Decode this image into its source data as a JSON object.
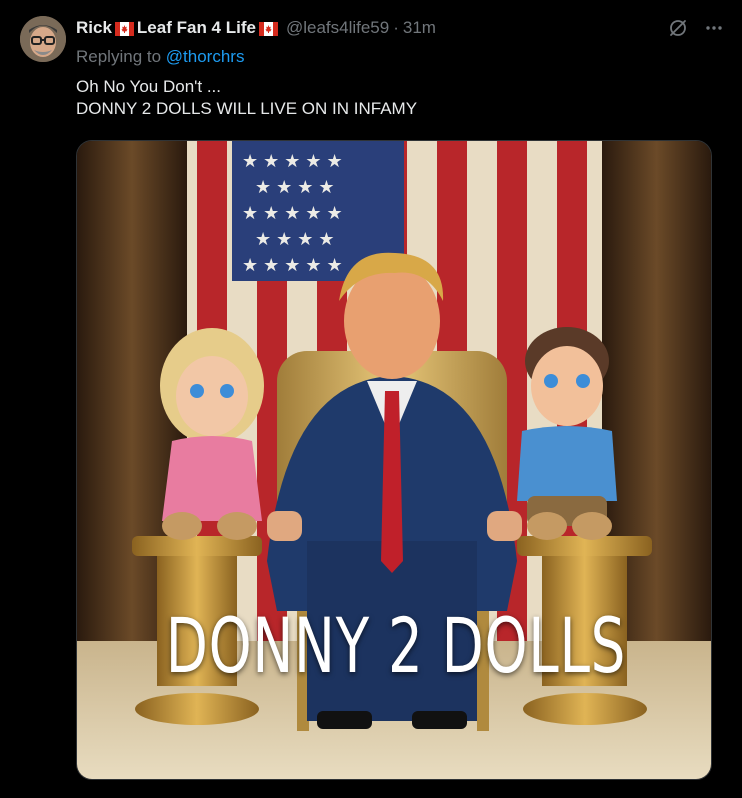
{
  "tweet": {
    "display_name": "Rick",
    "display_name_suffix": "Leaf Fan 4 Life",
    "handle": "@leafs4life59",
    "time": "31m",
    "replying_prefix": "Replying to",
    "replying_to": "@thorchrs",
    "text_line1": "Oh No You Don't ...",
    "text_line2": "DONNY 2 DOLLS WILL LIVE ON IN INFAMY",
    "image_caption": "DONNY 2 DOLLS"
  },
  "icons": {
    "grok": "grok-icon",
    "more": "more-icon",
    "flag": "canada-flag-icon"
  },
  "colors": {
    "background": "#000000",
    "primary_text": "#e7e9ea",
    "secondary_text": "#71767b",
    "link": "#1d9bf0"
  }
}
